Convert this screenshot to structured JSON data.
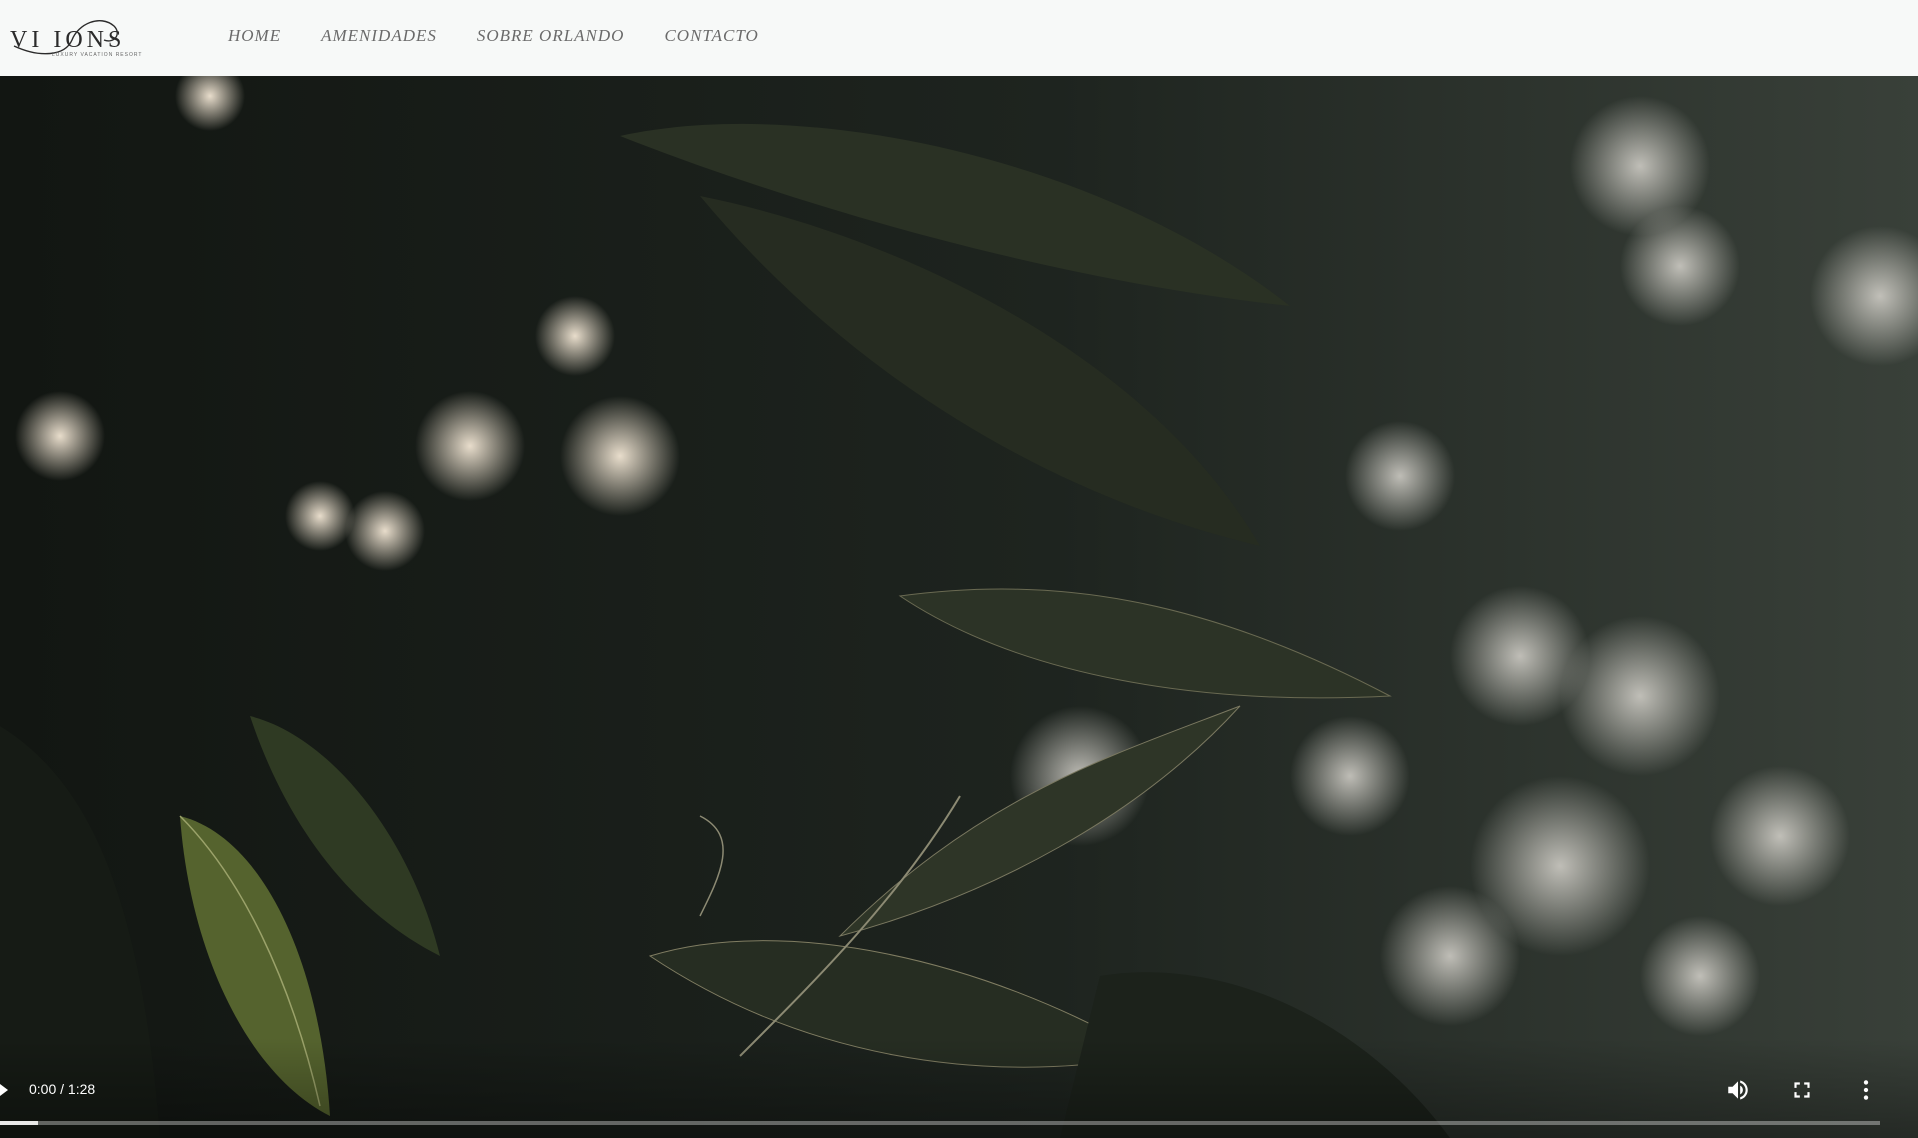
{
  "brand": {
    "name": "VI IONS",
    "tagline": "LUXURY VACATION RESORT"
  },
  "nav": {
    "items": [
      {
        "label": "HOME"
      },
      {
        "label": "AMENIDADES"
      },
      {
        "label": "SOBRE ORLANDO"
      },
      {
        "label": "CONTACTO"
      }
    ]
  },
  "video": {
    "time_display": "0:00 / 1:28",
    "current_time": "0:00",
    "duration": "1:28",
    "progress_fraction": 0.02,
    "icons": {
      "play": "play-icon",
      "volume": "volume-icon",
      "fullscreen": "fullscreen-icon",
      "menu": "more-vert-icon"
    }
  },
  "colors": {
    "header_bg": "#f7f9f8",
    "nav_text": "#6a6a6a",
    "video_bg": "#161a16"
  }
}
